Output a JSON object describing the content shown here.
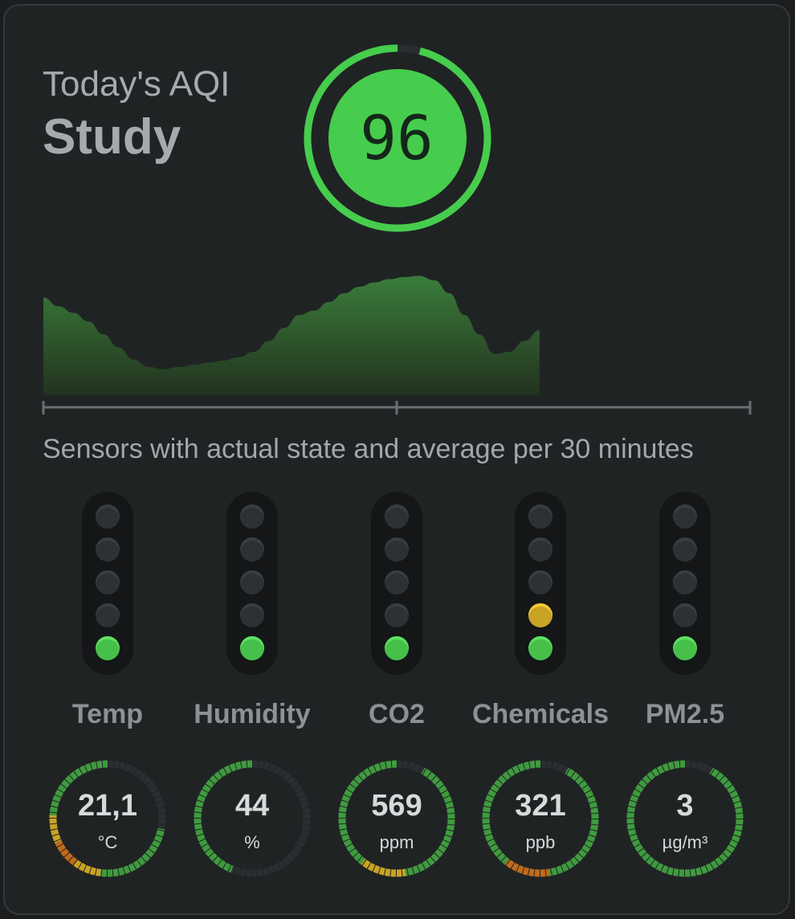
{
  "header": {
    "subtitle": "Today's AQI",
    "room": "Study",
    "aqi": "96",
    "aqi_fraction": 0.96,
    "aqi_color": "#46cd4d"
  },
  "chart_data": {
    "type": "area",
    "x": [
      0,
      1,
      2,
      3,
      4,
      5,
      6,
      7,
      8,
      9,
      10,
      11,
      12,
      13,
      14,
      15,
      16,
      17,
      18,
      19,
      20,
      21,
      22,
      23,
      24,
      25,
      26,
      27,
      28,
      29,
      30,
      31,
      32,
      33,
      34,
      35,
      36,
      37,
      38,
      39,
      40,
      41,
      42,
      43,
      44,
      45,
      46,
      47
    ],
    "values": [
      90,
      82,
      76,
      68,
      56,
      44,
      33,
      26,
      24,
      26,
      28,
      30,
      32,
      35,
      40,
      50,
      62,
      74,
      78,
      86,
      94,
      100,
      104,
      107,
      109,
      110,
      106,
      94,
      74,
      56,
      38,
      40,
      50,
      60,
      null,
      null,
      null,
      null,
      null,
      null,
      null,
      null,
      null,
      null,
      null,
      null,
      null,
      null
    ],
    "ylim": [
      0,
      120
    ],
    "color": "#3a7d3a",
    "grid": false
  },
  "sensors_caption": "Sensors with actual state and average per 30 minutes",
  "sensors": [
    {
      "name": "Temp",
      "value": "21,1",
      "unit": "°C",
      "level": 1,
      "fraction": 0.72,
      "segments": [
        "green",
        "yellow",
        "orange",
        "yellow",
        "green"
      ]
    },
    {
      "name": "Humidity",
      "value": "44",
      "unit": "%",
      "level": 1,
      "fraction": 0.44,
      "segments": [
        "green"
      ]
    },
    {
      "name": "CO2",
      "value": "569",
      "unit": "ppm",
      "level": 1,
      "fraction": 0.92,
      "segments": [
        "green",
        "yellow",
        "green"
      ]
    },
    {
      "name": "Chemicals",
      "value": "321",
      "unit": "ppb",
      "level": 2,
      "fraction": 0.92,
      "segments": [
        "green",
        "orange",
        "green"
      ]
    },
    {
      "name": "PM2.5",
      "value": "3",
      "unit": "µg/m³",
      "level": 1,
      "fraction": 0.92,
      "segments": [
        "green"
      ]
    }
  ],
  "colors": {
    "green": "#3f9b3f",
    "yellow": "#c8a325",
    "orange": "#c16a1b",
    "track": "#2b2e30"
  }
}
